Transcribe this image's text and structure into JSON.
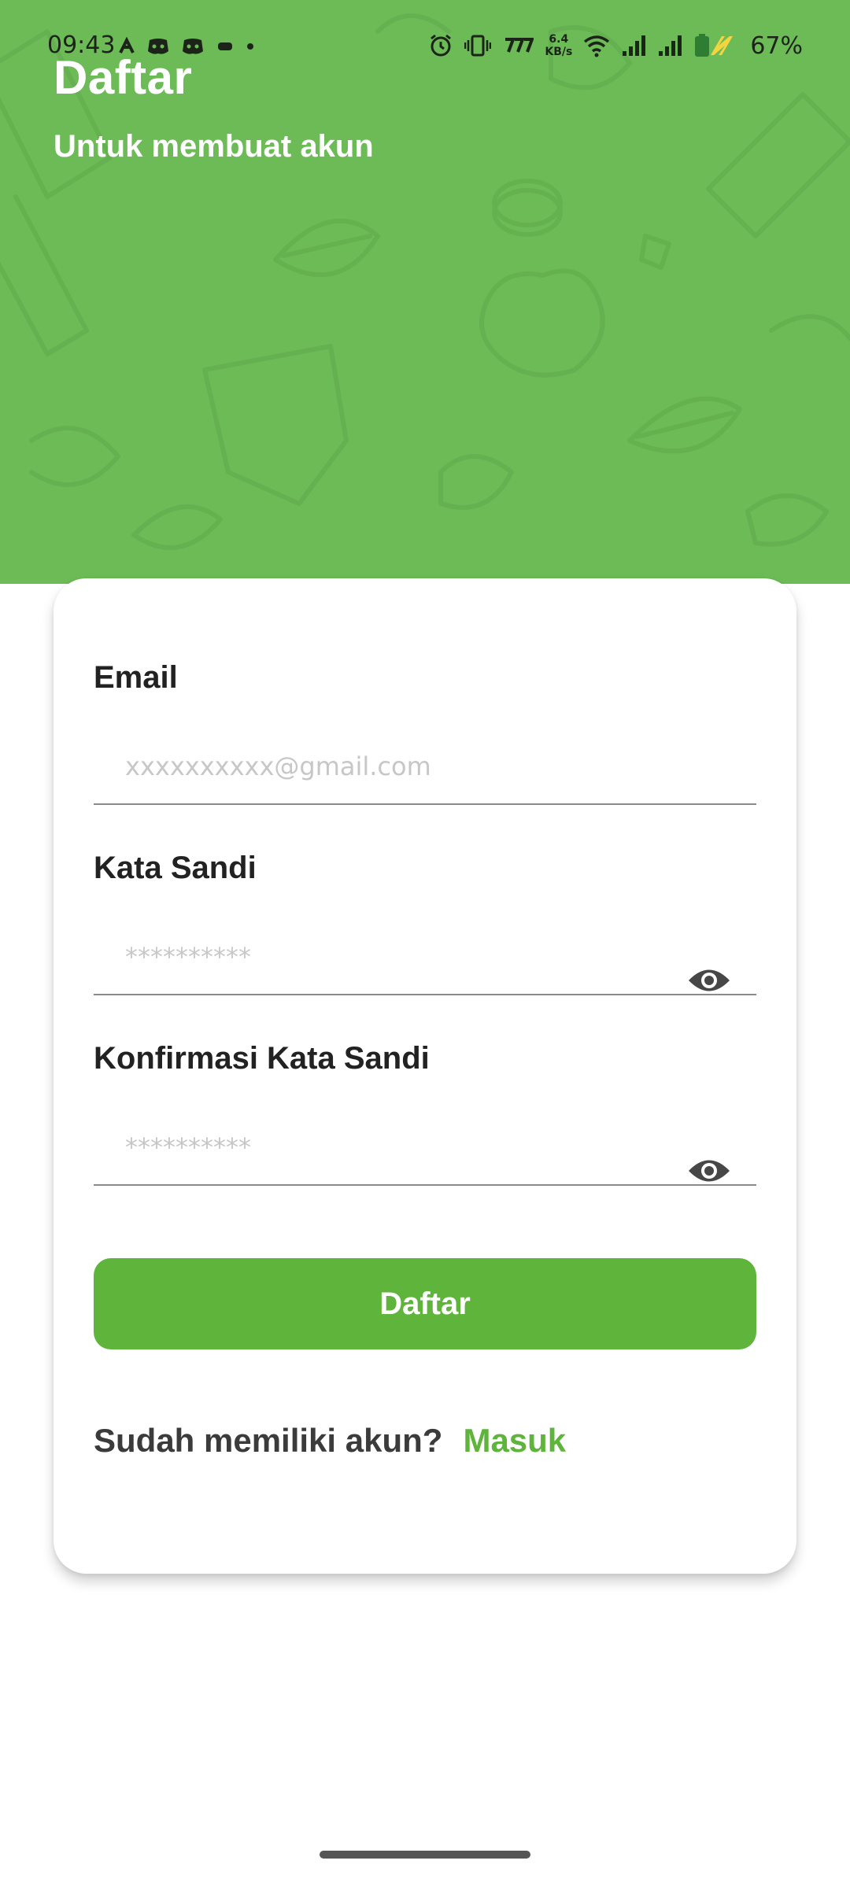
{
  "status_bar": {
    "time": "09:43",
    "net_speed_value": "6.4",
    "net_speed_unit": "KB/s",
    "battery_percent": "67%",
    "icons_left": [
      "app-notification-icon",
      "discord-icon",
      "discord-icon",
      "game-controller-icon",
      "dot-icon"
    ],
    "icons_right": [
      "alarm-icon",
      "vibrate-icon",
      "carrier-icon",
      "wifi-icon",
      "signal-icon",
      "signal-icon",
      "battery-charging-icon"
    ]
  },
  "header": {
    "title": "Daftar",
    "subtitle": "Untuk membuat akun",
    "background_color": "#6dbb57"
  },
  "form": {
    "email": {
      "label": "Email",
      "placeholder": "xxxxxxxxxx@gmail.com",
      "value": ""
    },
    "password": {
      "label": "Kata Sandi",
      "placeholder": "**********",
      "value": "",
      "toggle_icon": "eye-icon"
    },
    "confirm_password": {
      "label": "Konfirmasi Kata Sandi",
      "placeholder": "**********",
      "value": "",
      "toggle_icon": "eye-icon"
    },
    "submit_label": "Daftar"
  },
  "footer": {
    "question": "Sudah memiliki akun?",
    "login_link": "Masuk"
  },
  "colors": {
    "accent": "#5fb43c",
    "label": "#222222",
    "placeholder": "#c7c7c7"
  }
}
